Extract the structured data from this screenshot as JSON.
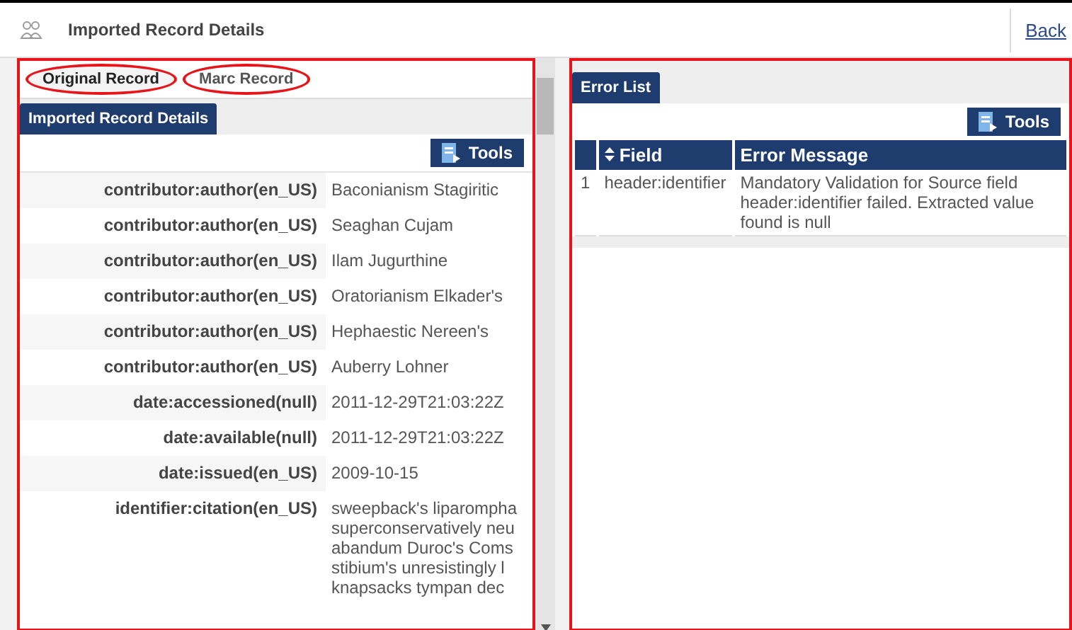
{
  "header": {
    "title": "Imported Record Details",
    "back_link": "Back"
  },
  "left_panel": {
    "tabs": [
      {
        "label": "Original Record",
        "selected": true
      },
      {
        "label": "Marc Record",
        "selected": false
      }
    ],
    "section_title": "Imported Record Details",
    "tools_button": "Tools",
    "rows": [
      {
        "label": "contributor:author(en_US)",
        "value": [
          "Baconianism Stagiritic"
        ]
      },
      {
        "label": "contributor:author(en_US)",
        "value": [
          "Seaghan Cujam"
        ]
      },
      {
        "label": "contributor:author(en_US)",
        "value": [
          "Ilam Jugurthine"
        ]
      },
      {
        "label": "contributor:author(en_US)",
        "value": [
          "Oratorianism Elkader's"
        ]
      },
      {
        "label": "contributor:author(en_US)",
        "value": [
          "Hephaestic Nereen's"
        ]
      },
      {
        "label": "contributor:author(en_US)",
        "value": [
          "Auberry Lohner"
        ]
      },
      {
        "label": "date:accessioned(null)",
        "value": [
          "2011-12-29T21:03:22Z"
        ]
      },
      {
        "label": "date:available(null)",
        "value": [
          "2011-12-29T21:03:22Z"
        ]
      },
      {
        "label": "date:issued(en_US)",
        "value": [
          "2009-10-15"
        ]
      },
      {
        "label": "identifier:citation(en_US)",
        "value": [
          "sweepback's liparompha",
          "superconservatively neu",
          "abandum Duroc's Coms",
          "stibium's unresistingly l",
          "knapsacks tympan dec"
        ]
      }
    ]
  },
  "right_panel": {
    "section_title": "Error List",
    "tools_button": "Tools",
    "table": {
      "columns": [
        "Field",
        "Error Message"
      ],
      "rows": [
        {
          "number": "1",
          "field": "header:identifier",
          "message": "Mandatory Validation for Source field header:identifier failed. Extracted value found is null"
        }
      ]
    }
  }
}
